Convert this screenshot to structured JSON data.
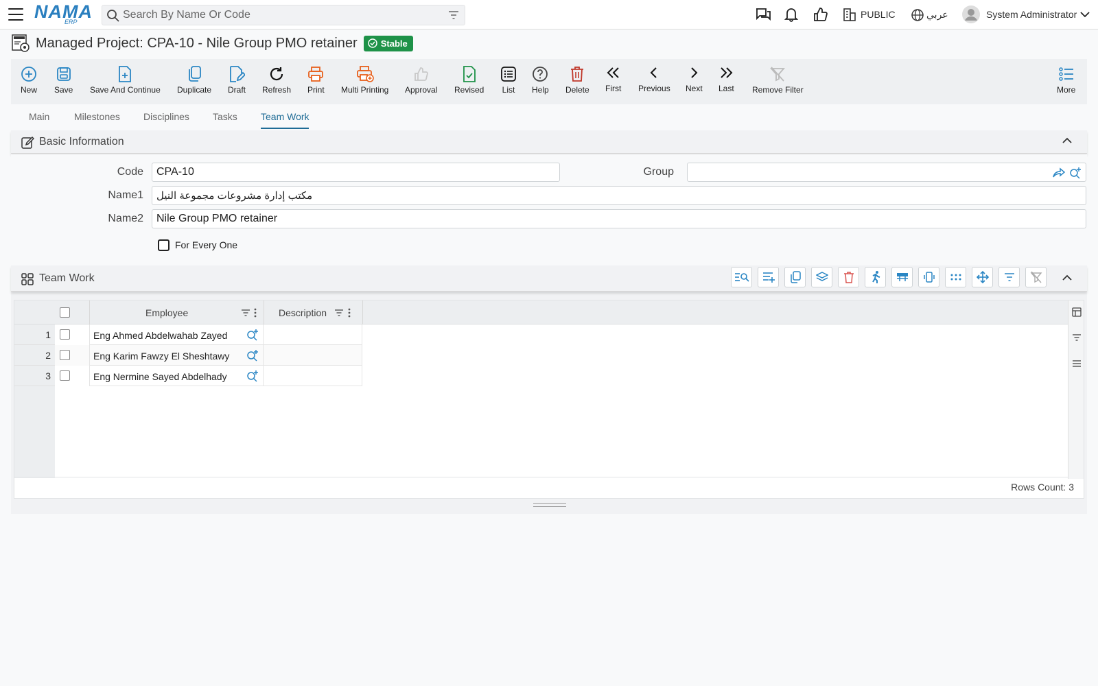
{
  "header": {
    "logo_text": "NAMA",
    "logo_sub": "ERP",
    "search_placeholder": "Search By Name Or Code",
    "branch_label": "PUBLIC",
    "language_label": "عربي",
    "user_name": "System Administrator"
  },
  "page": {
    "title": "Managed Project: CPA-10 - Nile Group PMO retainer",
    "status": "Stable",
    "status_color": "#1e9248"
  },
  "toolbar": {
    "new": "New",
    "save": "Save",
    "save_continue": "Save And Continue",
    "duplicate": "Duplicate",
    "draft": "Draft",
    "refresh": "Refresh",
    "print": "Print",
    "multi_printing": "Multi Printing",
    "approval": "Approval",
    "revised": "Revised",
    "list": "List",
    "help": "Help",
    "delete": "Delete",
    "first": "First",
    "previous": "Previous",
    "next": "Next",
    "last": "Last",
    "remove_filter": "Remove Filter",
    "more": "More"
  },
  "tabs": [
    "Main",
    "Milestones",
    "Disciplines",
    "Tasks",
    "Team Work"
  ],
  "active_tab": "Team Work",
  "basic_info": {
    "title": "Basic Information",
    "code_label": "Code",
    "code_value": "CPA-10",
    "group_label": "Group",
    "group_value": "",
    "name1_label": "Name1",
    "name1_value": "مكتب إدارة مشروعات مجموعة النيل",
    "name2_label": "Name2",
    "name2_value": "Nile Group PMO retainer",
    "for_every_one_label": "For Every One",
    "for_every_one_checked": false
  },
  "team_work": {
    "title": "Team Work",
    "columns": {
      "employee": "Employee",
      "description": "Description"
    },
    "rows": [
      {
        "num": "1",
        "employee": "Eng Ahmed Abdelwahab Zayed",
        "description": ""
      },
      {
        "num": "2",
        "employee": "Eng Karim Fawzy El Sheshtawy",
        "description": ""
      },
      {
        "num": "3",
        "employee": "Eng Nermine Sayed Abdelhady",
        "description": ""
      }
    ],
    "rows_count": "Rows Count: 3"
  },
  "colors": {
    "accent": "#2a86c4",
    "orange": "#e8601c",
    "red": "#c0392b",
    "green": "#1e9248"
  }
}
